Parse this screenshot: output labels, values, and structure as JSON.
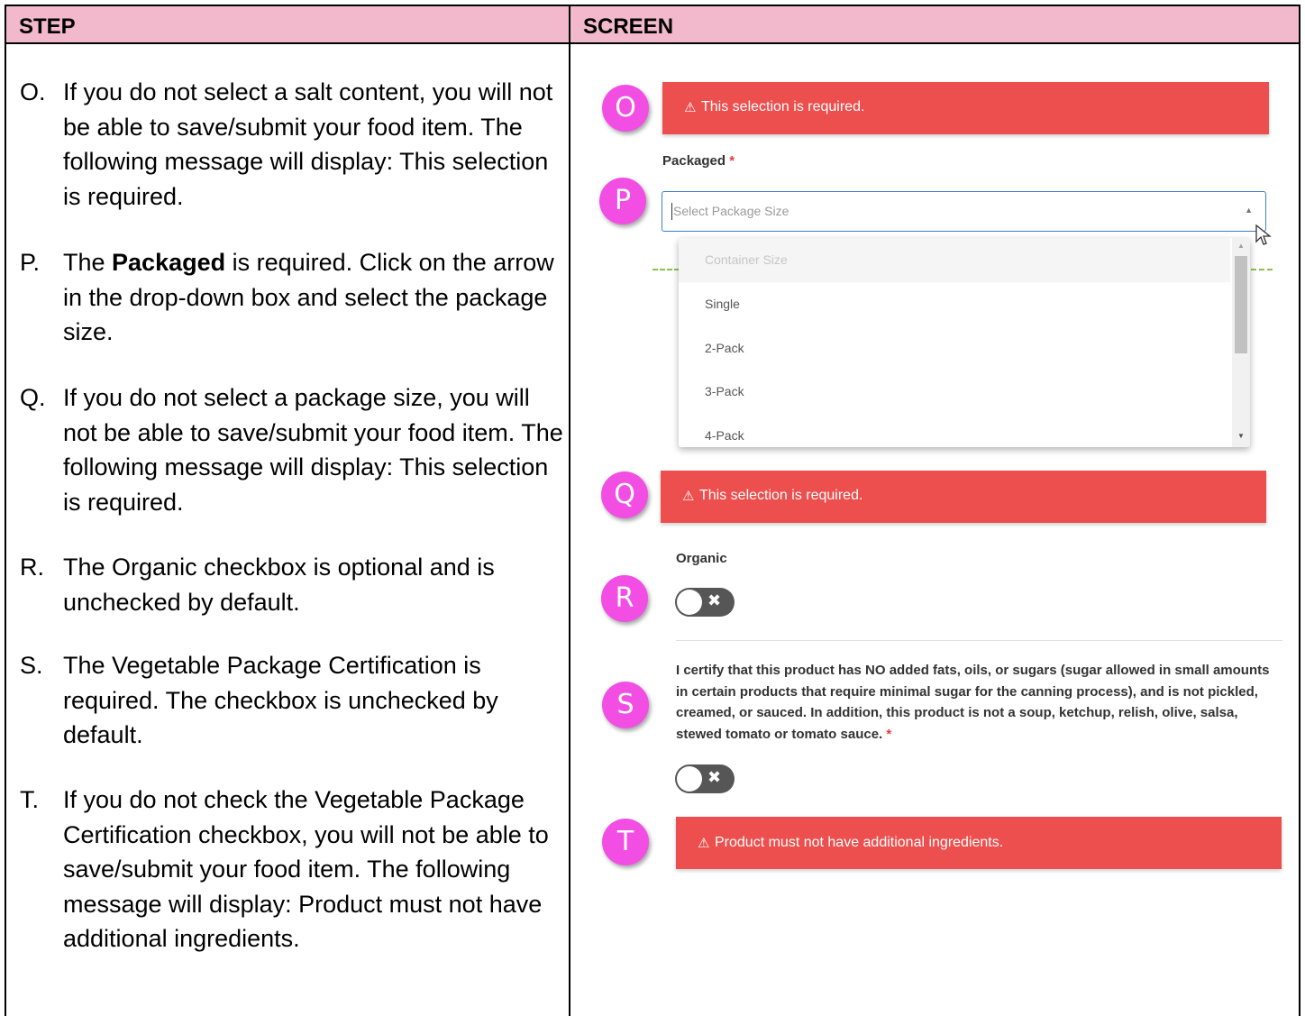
{
  "table": {
    "headers": {
      "step": "STEP",
      "screen": "SCREEN"
    }
  },
  "steps": [
    {
      "letter": "O.",
      "text": "If you do not select a salt content, you will not be able to save/submit your food item.  The following message will display: This selection is required."
    },
    {
      "letter": "P.",
      "pre": "The ",
      "bold": "Packaged",
      "post": " is required.   Click on the arrow in the drop-down box and select the package size."
    },
    {
      "letter": "Q.",
      "text": "If you do not select a package size, you will not be able to save/submit your food item.  The following message will display: This selection is required."
    },
    {
      "letter": "R.",
      "text": "The Organic checkbox is optional and is unchecked by default."
    },
    {
      "letter": "S.",
      "text": "The Vegetable Package Certification is required.  The checkbox is unchecked by default."
    },
    {
      "letter": "T.",
      "text": "If you do not check the Vegetable Package Certification checkbox, you will not be able to save/submit your food item.  The following message will display: Product must not have additional ingredients."
    }
  ],
  "markers": [
    "O",
    "P",
    "Q",
    "R",
    "S",
    "T"
  ],
  "screen": {
    "warning_glyph": "⚠",
    "error_o": "This selection is required.",
    "packaged_label": "Packaged",
    "required_mark": "*",
    "select_placeholder": "Select Package Size",
    "dropdown_options": [
      {
        "label": "Container Size",
        "disabled": true
      },
      {
        "label": "Single"
      },
      {
        "label": "2-Pack"
      },
      {
        "label": "3-Pack"
      },
      {
        "label": "4-Pack"
      }
    ],
    "error_q": "This selection is required.",
    "organic_label": "Organic",
    "organic_checked": false,
    "certification_text": "I certify that this product has NO added fats, oils, or sugars (sugar allowed in small amounts in certain products that require minimal sugar for the canning process), and is not pickled, creamed, or sauced. In addition, this product is not a soup, ketchup, relish, olive, salsa, stewed tomato or tomato sauce.",
    "certification_checked": false,
    "error_t": "Product must not have additional ingredients."
  },
  "colors": {
    "header_bg": "#f2b8cb",
    "marker": "#f24ee4",
    "error_bg": "#ec4f4d",
    "focus_border": "#3d7fc9",
    "divider_dashed": "#8bc34a"
  }
}
